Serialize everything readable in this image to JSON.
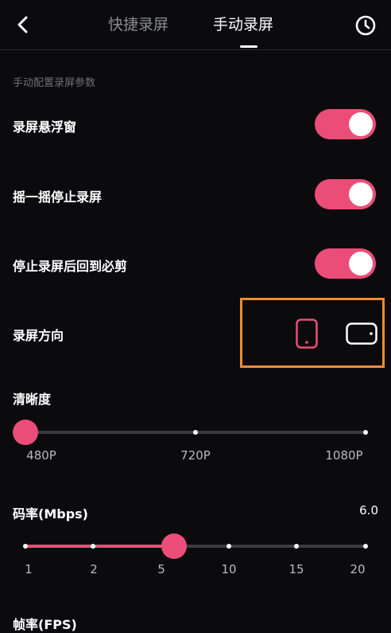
{
  "header": {
    "back_icon": "chevron-left-icon",
    "tabs": [
      {
        "label": "快捷录屏",
        "active": false
      },
      {
        "label": "手动录屏",
        "active": true
      }
    ],
    "history_icon": "clock-icon"
  },
  "section_hint": "手动配置录屏参数",
  "settings": {
    "floating_window": {
      "label": "录屏悬浮窗",
      "enabled": true
    },
    "shake_to_stop": {
      "label": "摇一摇停止录屏",
      "enabled": true
    },
    "return_after_stop": {
      "label": "停止录屏后回到必剪",
      "enabled": true
    },
    "orientation": {
      "label": "录屏方向",
      "options": [
        "portrait",
        "landscape"
      ],
      "selected": "portrait"
    }
  },
  "resolution": {
    "label": "清晰度",
    "ticks": [
      "480P",
      "720P",
      "1080P"
    ],
    "selected": "480P"
  },
  "bitrate": {
    "label": "码率(Mbps)",
    "value_text": "6.0",
    "ticks": [
      "1",
      "2",
      "5",
      "10",
      "15",
      "20"
    ],
    "selected_value": 6.0
  },
  "fps": {
    "label": "帧率(FPS)"
  },
  "colors": {
    "accent": "#ec4d78",
    "highlight_border": "#f28c2f",
    "background": "#0b0b0e"
  }
}
